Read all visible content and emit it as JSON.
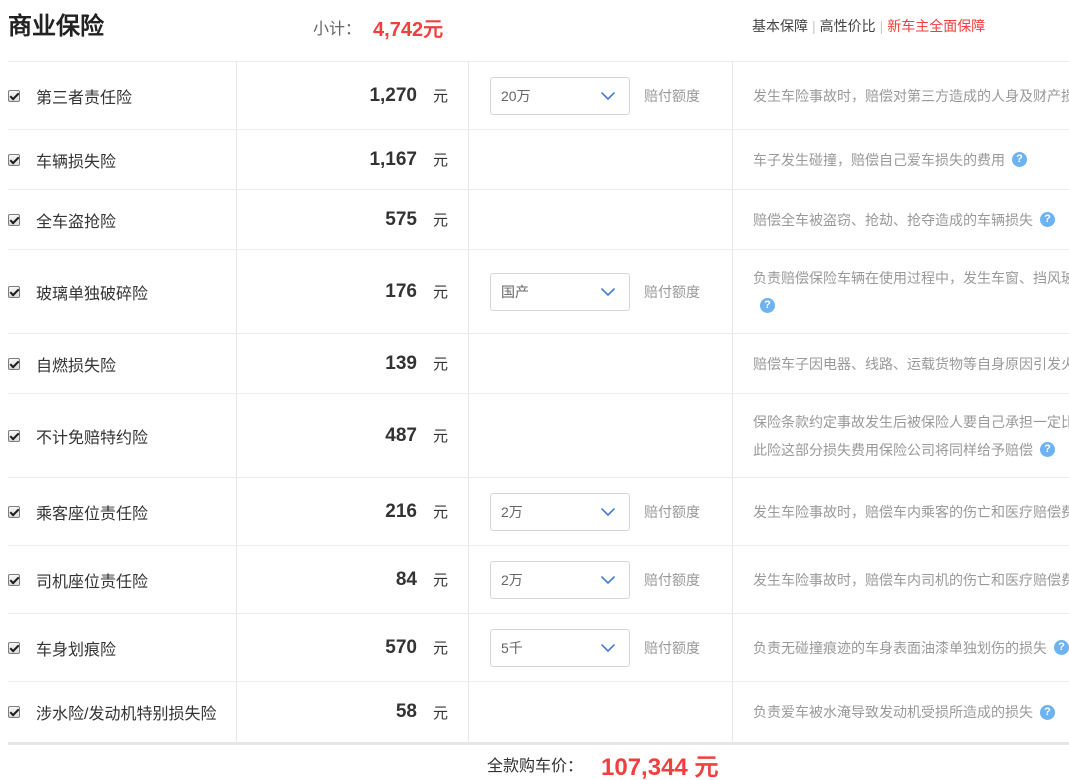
{
  "header": {
    "title": "商业保险",
    "subtotal_label": "小计：",
    "subtotal_value": "4,742元",
    "separator": "|",
    "plans": [
      {
        "label": "基本保障",
        "active": false
      },
      {
        "label": "高性价比",
        "active": false
      },
      {
        "label": "新车主全面保障",
        "active": true
      }
    ]
  },
  "colors": {
    "accent_red": "#f23e3e",
    "help_blue": "#6db3f2"
  },
  "icons": {
    "help": "question-circle-icon",
    "select": "chevron-down-icon"
  },
  "rows": [
    {
      "checked": true,
      "name": "第三者责任险",
      "price": "1,270",
      "unit": "元",
      "coverage": {
        "value": "20万",
        "label": "赔付额度"
      },
      "desc_lines": [
        "发生车险事故时，赔偿对第三方造成的人身及财产损"
      ],
      "help_icon": false
    },
    {
      "checked": true,
      "name": "车辆损失险",
      "price": "1,167",
      "unit": "元",
      "coverage": null,
      "desc_lines": [
        "车子发生碰撞，赔偿自己爱车损失的费用"
      ],
      "help_icon": true
    },
    {
      "checked": true,
      "name": "全车盗抢险",
      "price": "575",
      "unit": "元",
      "coverage": null,
      "desc_lines": [
        "赔偿全车被盗窃、抢劫、抢夺造成的车辆损失"
      ],
      "help_icon": true
    },
    {
      "checked": true,
      "name": "玻璃单独破碎险",
      "price": "176",
      "unit": "元",
      "coverage": {
        "value": "国产",
        "label": "赔付额度"
      },
      "desc_lines": [
        "负责赔偿保险车辆在使用过程中，发生车窗、挡风玻",
        ""
      ],
      "help_icon": true
    },
    {
      "checked": true,
      "name": "自燃损失险",
      "price": "139",
      "unit": "元",
      "coverage": null,
      "desc_lines": [
        "赔偿车子因电器、线路、运载货物等自身原因引发火"
      ],
      "help_icon": false
    },
    {
      "checked": true,
      "name": "不计免赔特约险",
      "price": "487",
      "unit": "元",
      "coverage": null,
      "desc_lines": [
        "保险条款约定事故发生后被保险人要自己承担一定比",
        "此险这部分损失费用保险公司将同样给予赔偿"
      ],
      "help_icon": true
    },
    {
      "checked": true,
      "name": "乘客座位责任险",
      "price": "216",
      "unit": "元",
      "coverage": {
        "value": "2万",
        "label": "赔付额度"
      },
      "desc_lines": [
        "发生车险事故时，赔偿车内乘客的伤亡和医疗赔偿费"
      ],
      "help_icon": false
    },
    {
      "checked": true,
      "name": "司机座位责任险",
      "price": "84",
      "unit": "元",
      "coverage": {
        "value": "2万",
        "label": "赔付额度"
      },
      "desc_lines": [
        "发生车险事故时，赔偿车内司机的伤亡和医疗赔偿费"
      ],
      "help_icon": false
    },
    {
      "checked": true,
      "name": "车身划痕险",
      "price": "570",
      "unit": "元",
      "coverage": {
        "value": "5千",
        "label": "赔付额度"
      },
      "desc_lines": [
        "负责无碰撞痕迹的车身表面油漆单独划伤的损失"
      ],
      "help_icon": true
    },
    {
      "checked": true,
      "name": "涉水险/发动机特别损失险",
      "price": "58",
      "unit": "元",
      "coverage": null,
      "desc_lines": [
        "负责爱车被水淹导致发动机受损所造成的损失"
      ],
      "help_icon": true
    }
  ],
  "footer": {
    "total_label": "全款购车价：",
    "total_value": "107,344 元"
  }
}
